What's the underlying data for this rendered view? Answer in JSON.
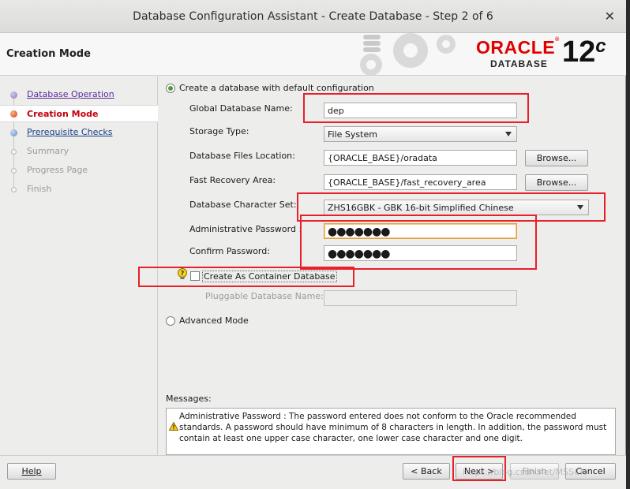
{
  "window": {
    "title": "Database Configuration Assistant - Create Database - Step 2 of 6",
    "close_glyph": "✕"
  },
  "header": {
    "step_title": "Creation Mode",
    "logo_text": "ORACLE",
    "logo_reg": "®",
    "logo_sub": "DATABASE",
    "version": "12",
    "version_suffix": "c"
  },
  "sidebar": {
    "items": [
      {
        "label": "Database Operation",
        "state": "done"
      },
      {
        "label": "Creation Mode",
        "state": "current"
      },
      {
        "label": "Prerequisite Checks",
        "state": "link"
      },
      {
        "label": "Summary",
        "state": "disabled"
      },
      {
        "label": "Progress Page",
        "state": "disabled"
      },
      {
        "label": "Finish",
        "state": "disabled"
      }
    ]
  },
  "form": {
    "default_config_label": "Create a database with default configuration",
    "global_db_name_label": "Global Database Name:",
    "global_db_name_value": "dep",
    "storage_type_label": "Storage Type:",
    "storage_type_value": "File System",
    "db_files_location_label": "Database Files Location:",
    "db_files_location_value": "{ORACLE_BASE}/oradata",
    "fast_recovery_label": "Fast Recovery Area:",
    "fast_recovery_value": "{ORACLE_BASE}/fast_recovery_area",
    "charset_label": "Database Character Set:",
    "charset_value": "ZHS16GBK - GBK 16-bit Simplified Chinese",
    "admin_password_label": "Administrative Password :",
    "admin_password_value": "●●●●●●●",
    "confirm_password_label": "Confirm Password:",
    "confirm_password_value": "●●●●●●●",
    "container_db_label": "Create As Container Database",
    "pluggable_db_label": "Pluggable Database Name:",
    "pluggable_db_value": "",
    "advanced_mode_label": "Advanced Mode",
    "browse_label": "Browse..."
  },
  "messages": {
    "label": "Messages:",
    "text": "Administrative Password : The password entered does not conform to the Oracle recommended standards. A password should have minimum of 8 characters in length. In addition, the password must contain at least one upper case character, one lower case character and one digit."
  },
  "buttons": {
    "help": "Help",
    "back": "< Back",
    "next": "Next >",
    "finish": "Finish",
    "cancel": "Cancel"
  },
  "watermark": "https://blog.csdn.net/MSSCN",
  "colors": {
    "accent_red": "#e00000",
    "current_step": "#c4000b",
    "annotation_red": "#e8202a",
    "link_blue": "#163e86"
  },
  "icons": {
    "hint": "lightbulb-icon",
    "warning": "warning-icon"
  }
}
